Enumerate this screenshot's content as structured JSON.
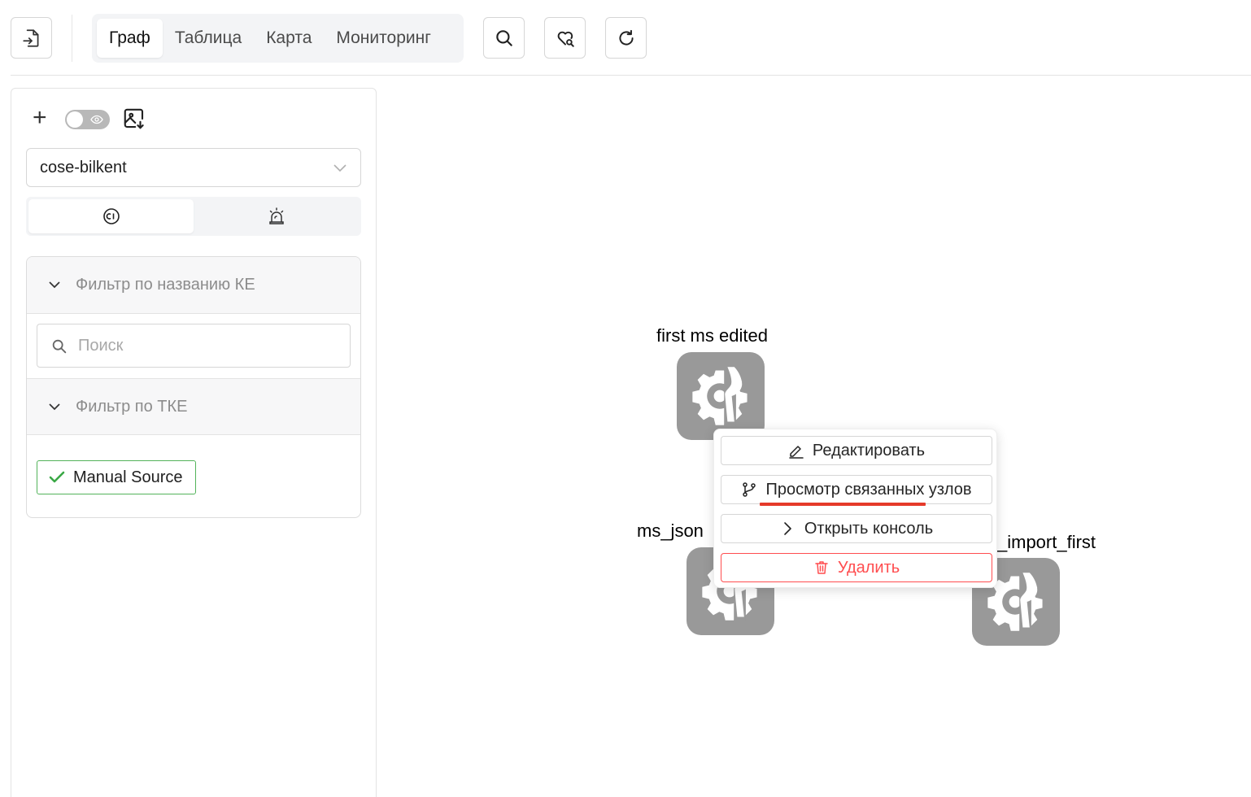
{
  "toolbar": {
    "tabs": [
      {
        "label": "Граф",
        "active": true
      },
      {
        "label": "Таблица",
        "active": false
      },
      {
        "label": "Карта",
        "active": false
      },
      {
        "label": "Мониторинг",
        "active": false
      }
    ],
    "icons": [
      "file-import-icon",
      "search-icon",
      "heart-search-icon",
      "refresh-icon"
    ]
  },
  "sidebar": {
    "layout_select": {
      "value": "cose-bilkent"
    },
    "segments": [
      "ci-icon",
      "siren-icon"
    ],
    "filters": {
      "by_name": {
        "label": "Фильтр по названию КЕ"
      },
      "search": {
        "placeholder": "Поиск"
      },
      "by_type": {
        "label": "Фильтр по ТКЕ"
      },
      "tags": [
        {
          "label": "Manual Source",
          "checked": true
        }
      ]
    }
  },
  "graph": {
    "nodes": [
      {
        "label": "first ms edited"
      },
      {
        "label": "ms_json"
      },
      {
        "label": "_import_first"
      }
    ],
    "node_color": "#999999"
  },
  "context_menu": {
    "items": [
      {
        "label": "Редактировать",
        "icon": "pencil-icon"
      },
      {
        "label": "Просмотр связанных узлов",
        "icon": "branch-icon"
      },
      {
        "label": "Открыть консоль",
        "icon": "terminal-icon"
      },
      {
        "label": "Удалить",
        "icon": "trash-icon",
        "color": "#ff4d4f"
      }
    ]
  },
  "colors": {
    "accent_red": "#e53a2a",
    "tag_green": "#52b35a"
  }
}
